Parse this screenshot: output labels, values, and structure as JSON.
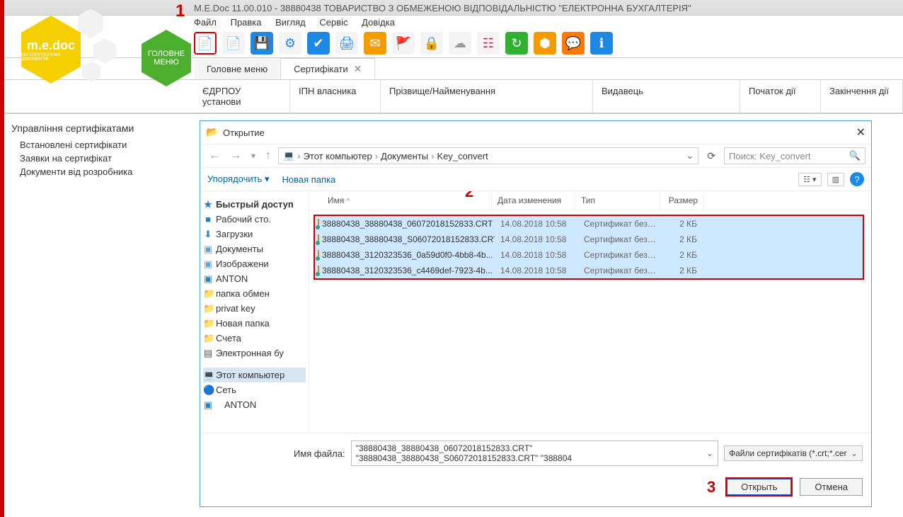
{
  "title": "M.E.Doc 11.00.010 - 38880438 ТОВАРИСТВО З ОБМЕЖЕНОЮ ВІДПОВІДАЛЬНІСТЮ \"ЕЛЕКТРОННА БУХГАЛТЕРІЯ\"",
  "logo": {
    "brand": "m.e.doc",
    "tagline": "МИ ЕЛЕКТРОННИХ ДОКУМЕНТІВ",
    "main_menu": "ГОЛОВНЕ МЕНЮ"
  },
  "menu": {
    "file": "Файл",
    "edit": "Правка",
    "view": "Вигляд",
    "service": "Сервіс",
    "help": "Довідка"
  },
  "tabs": {
    "main": "Головне меню",
    "certs": "Сертифікати"
  },
  "columns": {
    "edrpou": "ЄДРПОУ установи",
    "ipn": "ІПН власника",
    "name": "Прізвище/Найменування",
    "issuer": "Видавець",
    "start": "Початок дії",
    "end": "Закінчення дії"
  },
  "sidebar": {
    "heading": "Управління сертифікатами",
    "items": [
      "Встановлені сертифікати",
      "Заявки на сертифікат",
      "Документи від розробника"
    ]
  },
  "markers": {
    "m1": "1",
    "m2": "2",
    "m3": "3"
  },
  "dialog": {
    "title": "Открытие",
    "path": {
      "root": "Этот компьютер",
      "p1": "Документы",
      "p2": "Key_convert"
    },
    "search_placeholder": "Поиск: Key_convert",
    "organize": "Упорядочить",
    "newfolder": "Новая папка",
    "tree": [
      {
        "icon": "★",
        "label": "Быстрый доступ",
        "color": "#2a7fbd",
        "bold": true
      },
      {
        "icon": "■",
        "label": "Рабочий сто.",
        "color": "#2a7fbd"
      },
      {
        "icon": "⬇",
        "label": "Загрузки",
        "color": "#2a7fbd"
      },
      {
        "icon": "▣",
        "label": "Документы",
        "color": "#6aa0d0"
      },
      {
        "icon": "▣",
        "label": "Изображени",
        "color": "#6aa0d0"
      },
      {
        "icon": "▣",
        "label": "ANTON",
        "color": "#2a7fbd"
      },
      {
        "icon": "📁",
        "label": "папка обмен",
        "color": "#f0b030"
      },
      {
        "icon": "📁",
        "label": "privat key",
        "color": "#f0b030"
      },
      {
        "icon": "📁",
        "label": "Новая папка",
        "color": "#f0b030"
      },
      {
        "icon": "📁",
        "label": "Счета",
        "color": "#f0b030"
      },
      {
        "icon": "▤",
        "label": "Электронная бу",
        "color": "#555"
      }
    ],
    "tree2": [
      {
        "icon": "💻",
        "label": "Этот компьютер",
        "sel": true
      },
      {
        "icon": "🔵",
        "label": "Сеть"
      },
      {
        "icon": "▣",
        "label": "ANTON",
        "color": "#2a7fbd"
      }
    ],
    "file_headers": {
      "name": "Имя",
      "date": "Дата изменения",
      "type": "Тип",
      "size": "Размер"
    },
    "files": [
      {
        "name": "38880438_38880438_06072018152833.CRT",
        "date": "14.08.2018 10:58",
        "type": "Сертификат безо...",
        "size": "2 КБ"
      },
      {
        "name": "38880438_38880438_S06072018152833.CRT",
        "date": "14.08.2018 10:58",
        "type": "Сертификат безо...",
        "size": "2 КБ"
      },
      {
        "name": "38880438_3120323536_0a59d0f0-4bb8-4b...",
        "date": "14.08.2018 10:58",
        "type": "Сертификат безо...",
        "size": "2 КБ"
      },
      {
        "name": "38880438_3120323536_c4469def-7923-4b...",
        "date": "14.08.2018 10:58",
        "type": "Сертификат безо...",
        "size": "2 КБ"
      }
    ],
    "fname_label": "Имя файла:",
    "fname_value": "\"38880438_38880438_06072018152833.CRT\" \"38880438_38880438_S06072018152833.CRT\" \"388804",
    "filter": "Файли сертифікатів (*.crt;*.cer",
    "open": "Открыть",
    "cancel": "Отмена"
  }
}
